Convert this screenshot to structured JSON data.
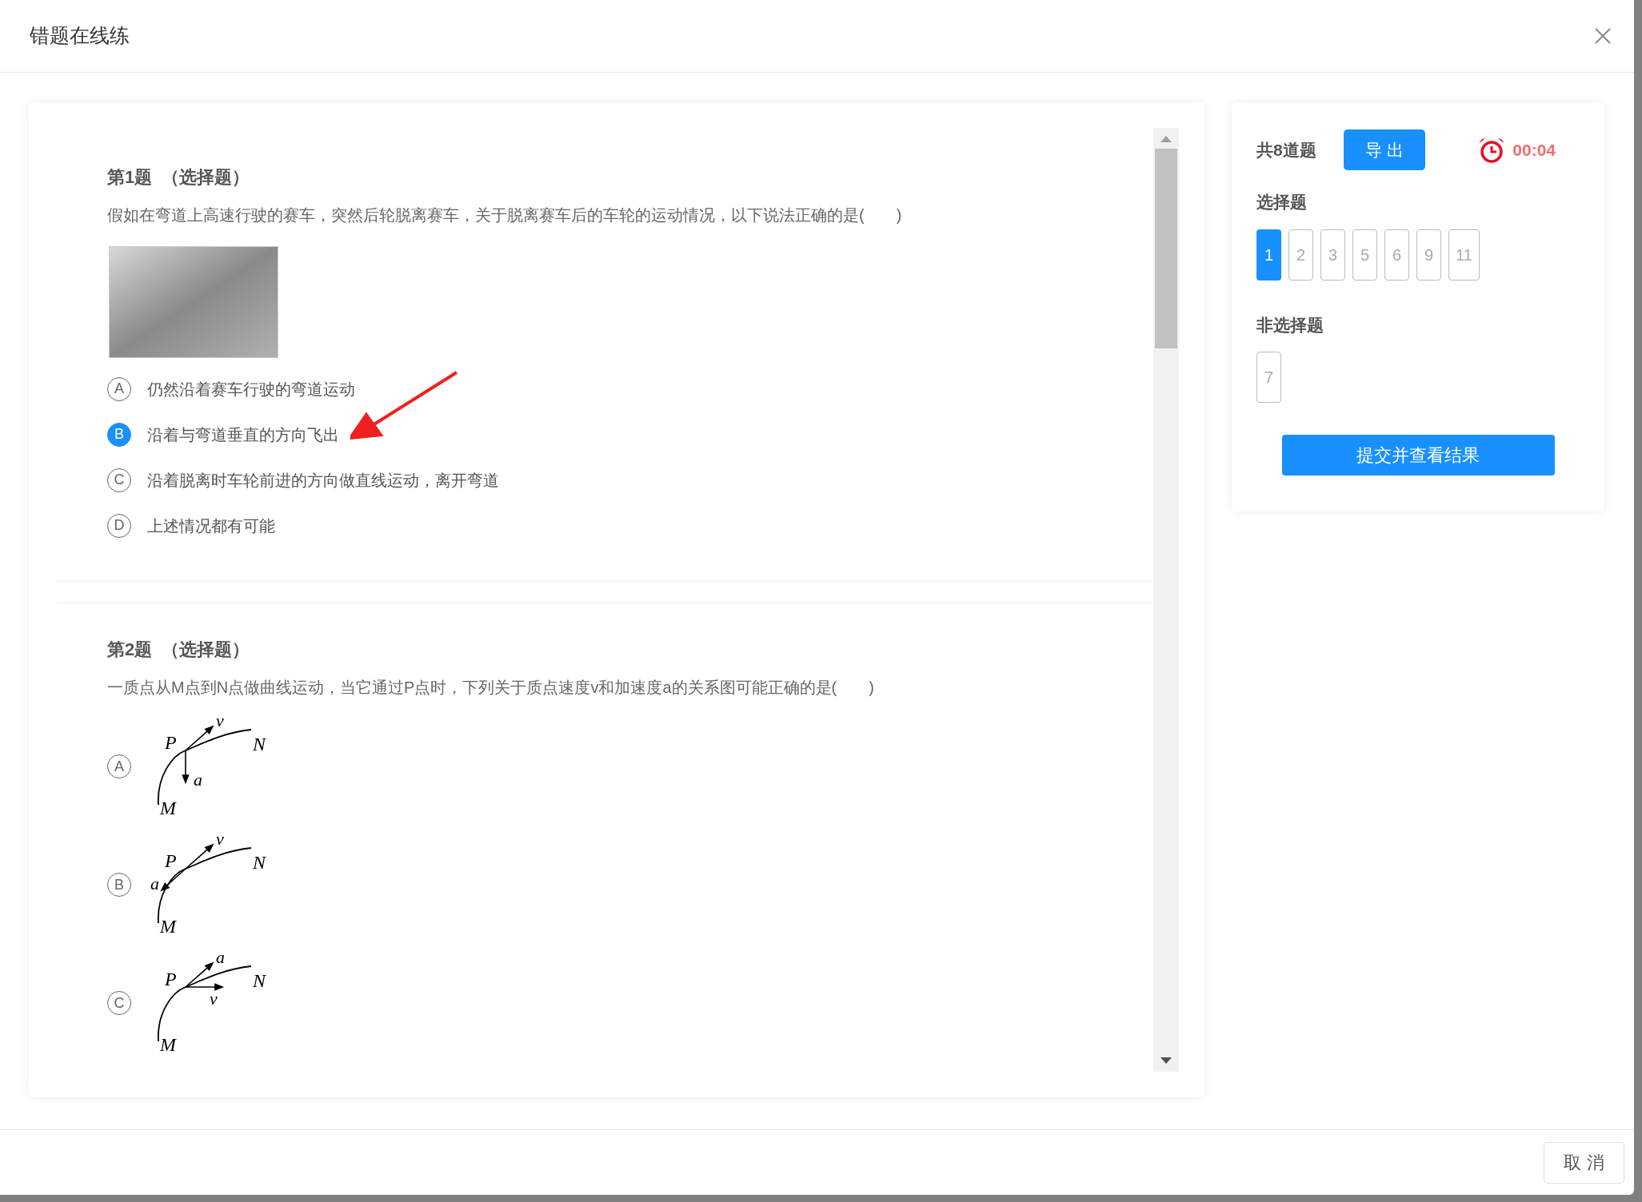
{
  "dialog": {
    "title": "错题在线练"
  },
  "questions": [
    {
      "title": "第1题  （选择题）",
      "text": "假如在弯道上高速行驶的赛车，突然后轮脱离赛车，关于脱离赛车后的车轮的运动情况，以下说法正确的是(　　)",
      "media": [
        {
          "kind": "photo"
        }
      ],
      "annotations": [
        {
          "kind": "arrow"
        }
      ],
      "options": [
        {
          "letter": "A",
          "kind": "text",
          "text": "仍然沿着赛车行驶的弯道运动",
          "selected": false
        },
        {
          "letter": "B",
          "kind": "text",
          "text": "沿着与弯道垂直的方向飞出",
          "selected": true
        },
        {
          "letter": "C",
          "kind": "text",
          "text": "沿着脱离时车轮前进的方向做直线运动，离开弯道",
          "selected": false
        },
        {
          "letter": "D",
          "kind": "text",
          "text": "上述情况都有可能",
          "selected": false
        }
      ]
    },
    {
      "title": "第2题  （选择题）",
      "text": "一质点从M点到N点做曲线运动，当它通过P点时，下列关于质点速度v和加速度a的关系图可能正确的是(　　)",
      "options": [
        {
          "letter": "A",
          "kind": "figure",
          "selected": false,
          "figure": {
            "point": "P",
            "start": "M",
            "end": "N",
            "arrows": [
              {
                "label": "v",
                "kind": "tangent"
              },
              {
                "label": "a",
                "kind": "down"
              }
            ]
          }
        },
        {
          "letter": "B",
          "kind": "figure",
          "selected": false,
          "figure": {
            "point": "P",
            "start": "M",
            "end": "N",
            "arrows": [
              {
                "label": "v",
                "kind": "tangent"
              },
              {
                "label": "a",
                "kind": "backward"
              }
            ]
          }
        },
        {
          "letter": "C",
          "kind": "figure",
          "selected": false,
          "figure": {
            "point": "P",
            "start": "M",
            "end": "N",
            "arrows": [
              {
                "label": "a",
                "kind": "tangent"
              },
              {
                "label": "v",
                "kind": "right"
              }
            ]
          }
        }
      ]
    }
  ],
  "panel": {
    "summary": "共8道题",
    "export_button": "导 出",
    "timer": "00:04",
    "groups": [
      {
        "title": "选择题",
        "numbers": [
          {
            "label": "1",
            "selected": true
          },
          {
            "label": "2",
            "selected": false
          },
          {
            "label": "3",
            "selected": false
          },
          {
            "label": "5",
            "selected": false
          },
          {
            "label": "6",
            "selected": false
          },
          {
            "label": "9",
            "selected": false
          },
          {
            "label": "11",
            "selected": false
          }
        ]
      },
      {
        "title": "非选择题",
        "numbers": [
          {
            "label": "7",
            "selected": false
          }
        ]
      }
    ],
    "submit_button": "提交并查看结果"
  },
  "footer": {
    "cancel_button": "取 消"
  }
}
